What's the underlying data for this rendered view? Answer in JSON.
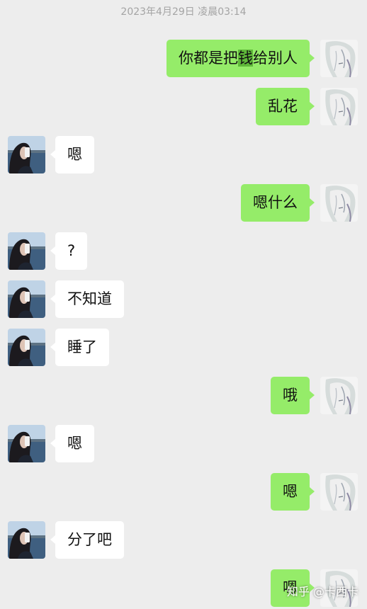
{
  "timestamp": "2023年4月29日 凌晨03:14",
  "colors": {
    "background": "#EDEDED",
    "self_bubble": "#95EC69",
    "other_bubble": "#FFFFFF"
  },
  "messages": [
    {
      "sender": "self",
      "text_pre": "你都是把",
      "text_hl": "钱",
      "text_post": "给别人"
    },
    {
      "sender": "self",
      "text": "乱花"
    },
    {
      "sender": "other",
      "text": "嗯"
    },
    {
      "sender": "self",
      "text": "嗯什么"
    },
    {
      "sender": "other",
      "text": "?"
    },
    {
      "sender": "other",
      "text": "不知道"
    },
    {
      "sender": "other",
      "text": "睡了"
    },
    {
      "sender": "self",
      "text": "哦"
    },
    {
      "sender": "other",
      "text": "嗯"
    },
    {
      "sender": "self",
      "text": "嗯"
    },
    {
      "sender": "other",
      "text": "分了吧"
    },
    {
      "sender": "self",
      "text": "嗯"
    }
  ],
  "avatars": {
    "self": "anime-girl-avatar",
    "other": "seaside-girl-avatar"
  },
  "watermark": "知乎 @卡西卡"
}
